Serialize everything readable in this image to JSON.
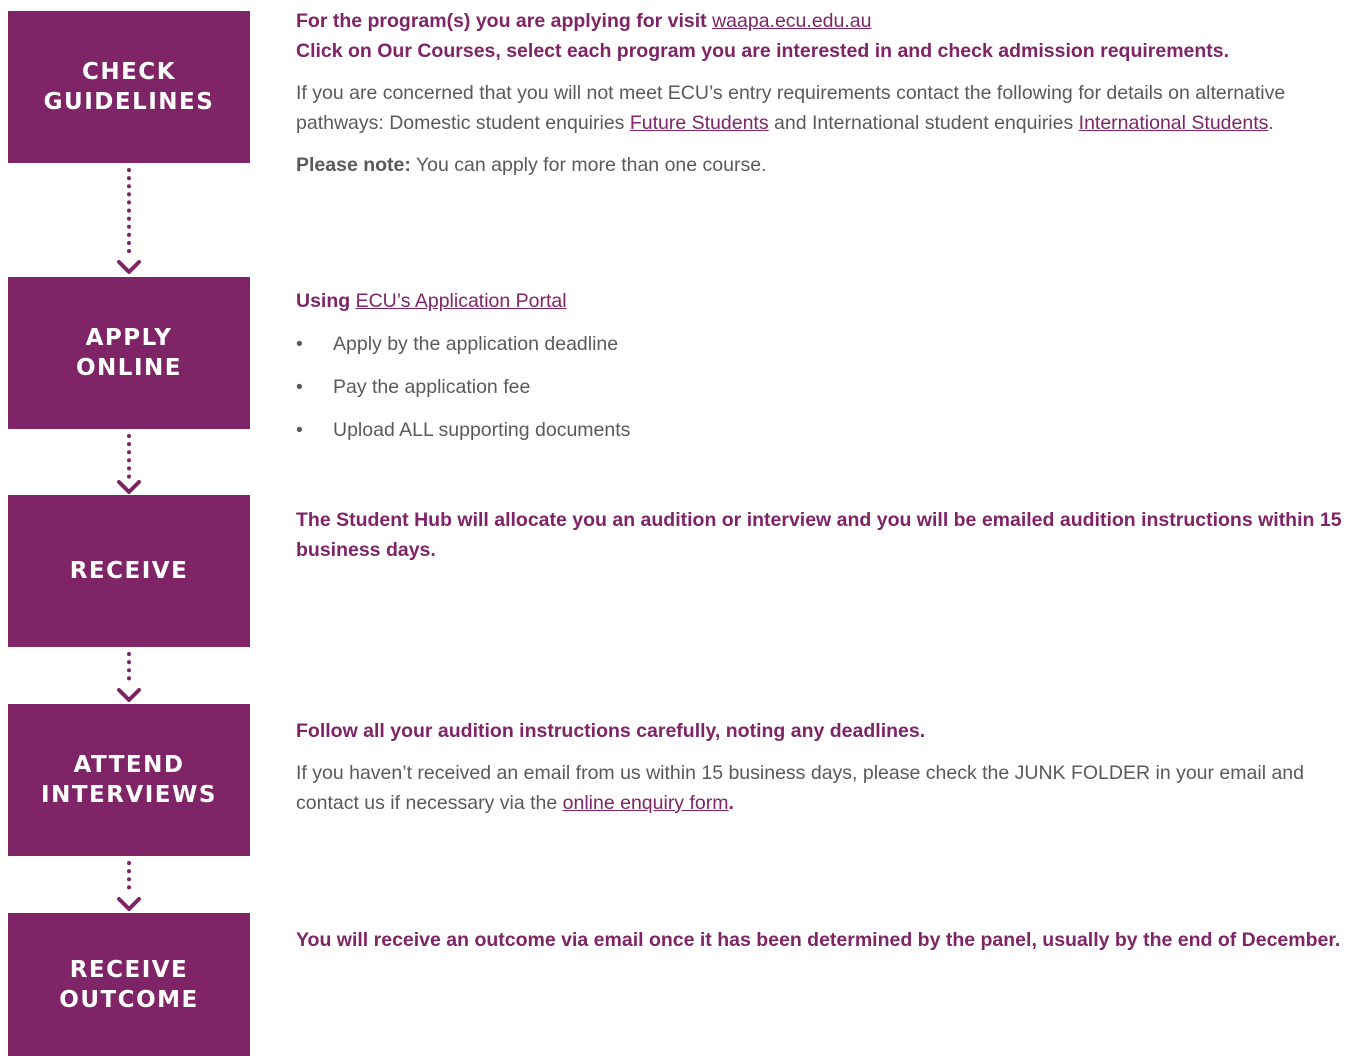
{
  "colors": {
    "accent": "#7f2466",
    "body_text": "#5a5a5a",
    "box_text": "#ffffff"
  },
  "steps": [
    {
      "line1": "CHECK",
      "line2": "GUIDELINES"
    },
    {
      "line1": "APPLY",
      "line2": "ONLINE"
    },
    {
      "line1": "RECEIVE",
      "line2": ""
    },
    {
      "line1": "ATTEND",
      "line2": "INTERVIEWS"
    },
    {
      "line1": "RECEIVE",
      "line2": "OUTCOME"
    }
  ],
  "step1": {
    "intro_bold": "For the program(s) you are applying for visit",
    "intro_link": "waapa.ecu.edu.au",
    "instruction": "Click on Our Courses, select each program you are interested in and check admission requirements.",
    "para_part1": "If you are concerned that you will not meet ECU’s entry requirements contact the following for details on alternative pathways: Domestic student enquiries",
    "link_future": "Future Students",
    "para_part2": "and International student enquiries",
    "link_international": "International Students",
    "para_end": ".",
    "note_label": "Please note:",
    "note_text": "You can apply for more than one course."
  },
  "step2": {
    "using_label": "Using",
    "portal_link": "ECU’s Application Portal",
    "bullet_glyph": "•",
    "bullets": [
      "Apply by the application deadline",
      "Pay the application fee",
      "Upload ALL supporting documents"
    ]
  },
  "step3": {
    "text": "The Student Hub will allocate you an audition or interview and you will be emailed audition instructions within 15 business days."
  },
  "step4": {
    "bold": "Follow all your audition instructions carefully, noting any deadlines.",
    "para_part1": "If you haven’t received an email from us within 15 business days, please check the JUNK FOLDER in your email and contact us if necessary via the",
    "form_link": "online enquiry form",
    "para_end": "."
  },
  "step5": {
    "text": "You will receive an outcome via email once it has been determined by the panel, usually by the end of December."
  }
}
